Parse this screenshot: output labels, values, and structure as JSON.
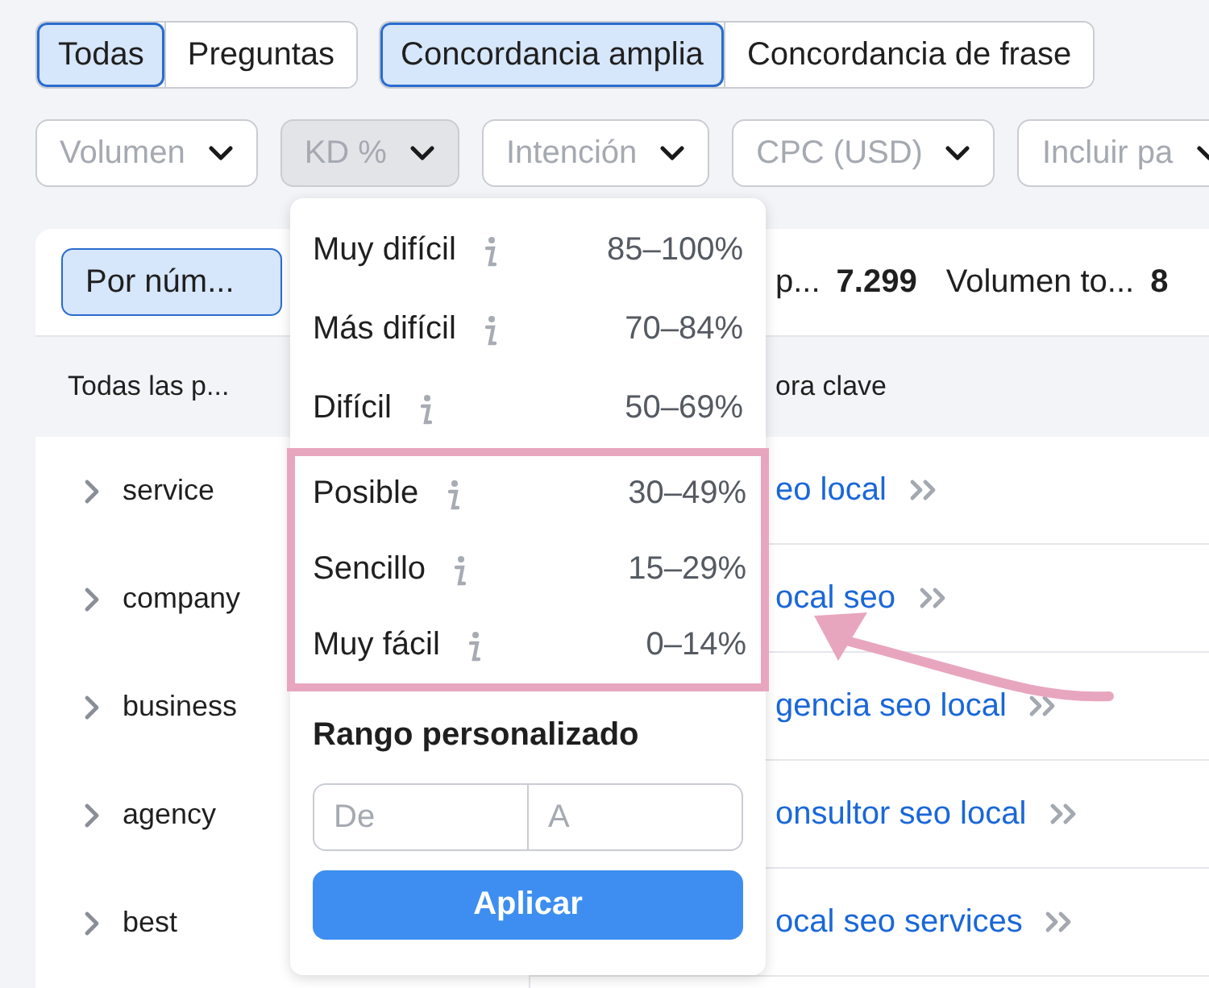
{
  "type_tabs": [
    {
      "label": "Todas",
      "selected": true
    },
    {
      "label": "Preguntas",
      "selected": false
    }
  ],
  "match_tabs": [
    {
      "label": "Concordancia amplia",
      "selected": true
    },
    {
      "label": "Concordancia de frase",
      "selected": false
    }
  ],
  "filters": [
    {
      "label": "Volumen",
      "open": false
    },
    {
      "label": "KD %",
      "open": true
    },
    {
      "label": "Intención",
      "open": false
    },
    {
      "label": "CPC (USD)",
      "open": false
    },
    {
      "label": "Incluir pa",
      "open": false
    }
  ],
  "group_button": {
    "label": "Por núm...",
    "selected": true
  },
  "groups_header": "Todas las p...",
  "groups": [
    {
      "label": "service"
    },
    {
      "label": "company"
    },
    {
      "label": "business"
    },
    {
      "label": "agency"
    },
    {
      "label": "best"
    }
  ],
  "stats": {
    "keywords_label": "p...",
    "keywords_value": "7.299",
    "volume_label": "Volumen to...",
    "volume_value": "8"
  },
  "keywords_header": "ora clave",
  "keywords": [
    "eo local",
    "ocal seo",
    "gencia seo local",
    "onsultor seo local",
    "ocal seo services"
  ],
  "kd_menu": {
    "options": [
      {
        "label": "Muy difícil",
        "range": "85–100%",
        "highlighted": false
      },
      {
        "label": "Más difícil",
        "range": "70–84%",
        "highlighted": false
      },
      {
        "label": "Difícil",
        "range": "50–69%",
        "highlighted": false
      },
      {
        "label": "Posible",
        "range": "30–49%",
        "highlighted": true
      },
      {
        "label": "Sencillo",
        "range": "15–29%",
        "highlighted": true
      },
      {
        "label": "Muy fácil",
        "range": "0–14%",
        "highlighted": true
      }
    ],
    "custom_title": "Rango personalizado",
    "from_placeholder": "De",
    "to_placeholder": "A",
    "apply": "Aplicar"
  }
}
